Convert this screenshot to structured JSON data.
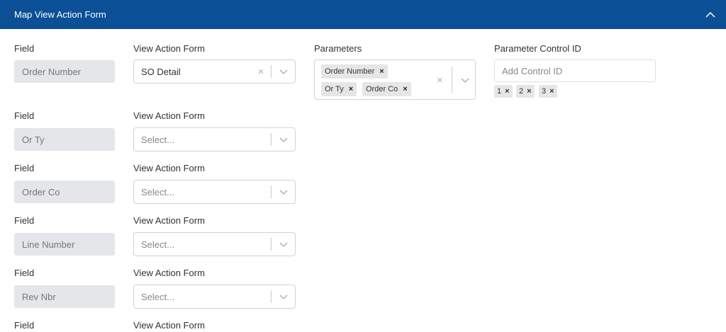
{
  "header": {
    "title": "Map View Action Form",
    "collapse_icon": "chevron-up-icon"
  },
  "labels": {
    "field": "Field",
    "view_action_form": "View Action Form",
    "parameters": "Parameters",
    "parameter_control_id": "Parameter Control ID"
  },
  "rows": [
    {
      "field": "Order Number",
      "view_action_form": "SO Detail"
    },
    {
      "field": "Or Ty",
      "view_action_form": "Select..."
    },
    {
      "field": "Order Co",
      "view_action_form": "Select..."
    },
    {
      "field": "Line Number",
      "view_action_form": "Select..."
    },
    {
      "field": "Rev Nbr",
      "view_action_form": "Select..."
    }
  ],
  "parameters": [
    "Order Number",
    "Or Ty",
    "Order Co"
  ],
  "control_id": {
    "placeholder": "Add Control ID",
    "tags": [
      "1",
      "2",
      "3"
    ]
  },
  "icons": {
    "clear": "×",
    "remove": "×"
  },
  "colors": {
    "header_bg": "#0b4f96",
    "field_bg": "#e4e6e9",
    "chip_bg": "#e6e6e6"
  }
}
